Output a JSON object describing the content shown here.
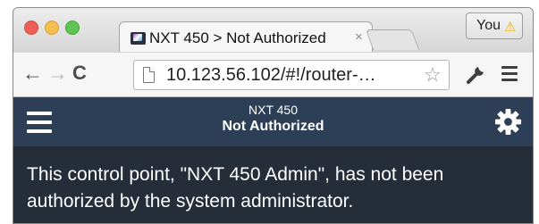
{
  "browser": {
    "tab": {
      "title": "NXT 450 > Not Authorized",
      "close_glyph": "×"
    },
    "profile": {
      "name": "You",
      "badge_icon": "warning-icon"
    },
    "toolbar": {
      "back_glyph": "←",
      "forward_glyph": "→",
      "reload_glyph": "C",
      "url": "10.123.56.102/#!/router-…",
      "bookmark_glyph": "☆"
    }
  },
  "app": {
    "header": {
      "device_name": "NXT 450",
      "status_title": "Not Authorized",
      "menu_icon": "hamburger-icon",
      "settings_icon": "gear-icon"
    },
    "message": "This control point, \"NXT 450 Admin\", has not been authorized by the system administrator."
  },
  "colors": {
    "header_bg": "#2d3f57",
    "body_bg": "#252d38",
    "text": "#ffffff",
    "warning": "#f0b400"
  }
}
